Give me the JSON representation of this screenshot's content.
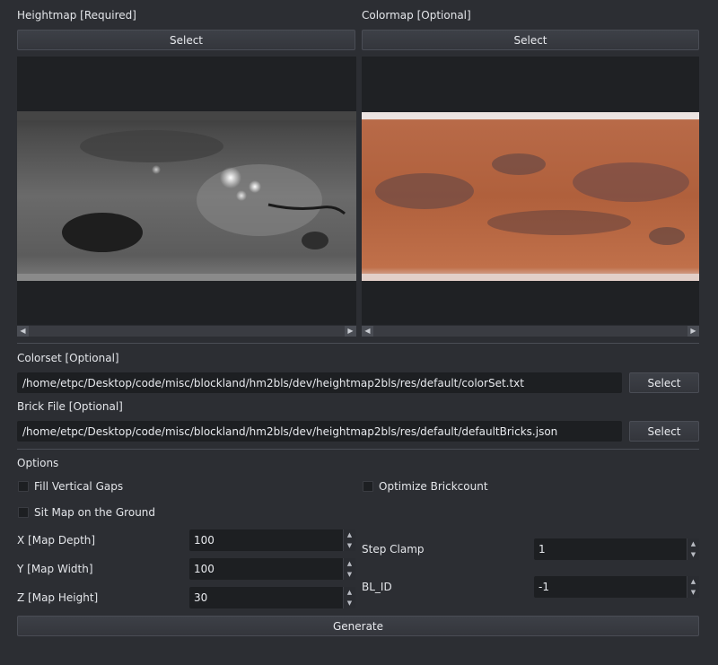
{
  "heightmap": {
    "title": "Heightmap [Required]",
    "select_label": "Select"
  },
  "colormap": {
    "title": "Colormap [Optional]",
    "select_label": "Select"
  },
  "colorset": {
    "title": "Colorset [Optional]",
    "path": "/home/etpc/Desktop/code/misc/blockland/hm2bls/dev/heightmap2bls/res/default/colorSet.txt",
    "select_label": "Select"
  },
  "brickfile": {
    "title": "Brick File [Optional]",
    "path": "/home/etpc/Desktop/code/misc/blockland/hm2bls/dev/heightmap2bls/res/default/defaultBricks.json",
    "select_label": "Select"
  },
  "options": {
    "title": "Options",
    "fill_vertical_gaps": "Fill Vertical Gaps",
    "optimize_brickcount": "Optimize Brickcount",
    "sit_map_on_ground": "Sit Map on the Ground",
    "x_label": "X [Map Depth]",
    "x_value": "100",
    "y_label": "Y [Map Width]",
    "y_value": "100",
    "z_label": "Z [Map Height]",
    "z_value": "30",
    "step_clamp_label": "Step Clamp",
    "step_clamp_value": "1",
    "blid_label": "BL_ID",
    "blid_value": "-1"
  },
  "generate_label": "Generate",
  "icons": {
    "scroll_left": "◀",
    "scroll_right": "▶",
    "spin_up": "▲",
    "spin_down": "▼"
  }
}
